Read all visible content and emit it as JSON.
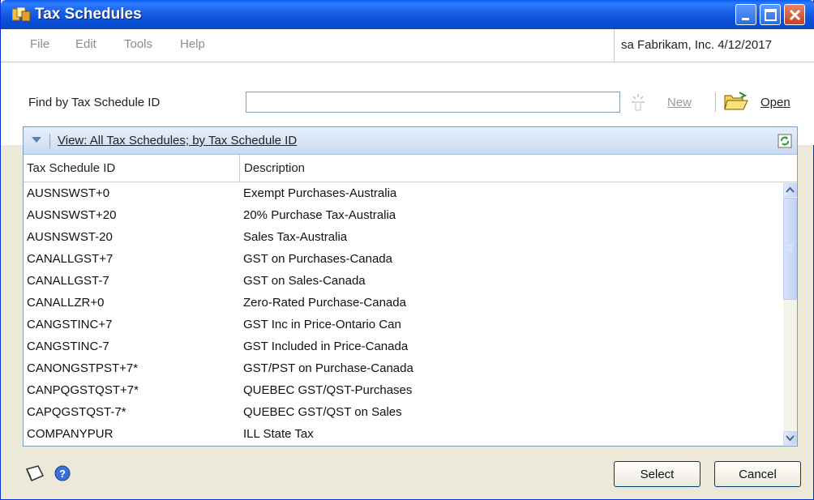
{
  "window": {
    "title": "Tax Schedules"
  },
  "menu": {
    "items": [
      "File",
      "Edit",
      "Tools",
      "Help"
    ]
  },
  "status": {
    "company": "sa  Fabrikam, Inc.  4/12/2017"
  },
  "find": {
    "label": "Find by Tax Schedule ID",
    "value": "",
    "new_label": "New",
    "open_label": "Open"
  },
  "view": {
    "label": "View: All Tax Schedules; by Tax Schedule ID"
  },
  "columns": {
    "id": "Tax Schedule ID",
    "description": "Description"
  },
  "rows": [
    {
      "id": "AUSNSWST+0",
      "description": "Exempt Purchases-Australia"
    },
    {
      "id": "AUSNSWST+20",
      "description": "20% Purchase Tax-Australia"
    },
    {
      "id": "AUSNSWST-20",
      "description": "Sales Tax-Australia"
    },
    {
      "id": "CANALLGST+7",
      "description": "GST on Purchases-Canada"
    },
    {
      "id": "CANALLGST-7",
      "description": "GST on Sales-Canada"
    },
    {
      "id": "CANALLZR+0",
      "description": "Zero-Rated Purchase-Canada"
    },
    {
      "id": "CANGSTINC+7",
      "description": "GST Inc in Price-Ontario Can"
    },
    {
      "id": "CANGSTINC-7",
      "description": "GST Included in Price-Canada"
    },
    {
      "id": "CANONGSTPST+7*",
      "description": "GST/PST on Purchase-Canada"
    },
    {
      "id": "CANPQGSTQST+7*",
      "description": "QUEBEC GST/QST-Purchases"
    },
    {
      "id": "CAPQGSTQST-7*",
      "description": "QUEBEC GST/QST on Sales"
    },
    {
      "id": "COMPANYPUR",
      "description": "ILL State Tax"
    }
  ],
  "buttons": {
    "select": "Select",
    "cancel": "Cancel"
  },
  "icons": {
    "app": "tax-schedules-icon",
    "new": "new-icon",
    "open": "open-folder-icon",
    "refresh": "refresh-icon",
    "note": "note-icon",
    "help": "help-icon"
  },
  "colors": {
    "titlebar": "#0a5cf0",
    "chrome": "#ece9d8",
    "viewbar": "#c9daf1"
  }
}
